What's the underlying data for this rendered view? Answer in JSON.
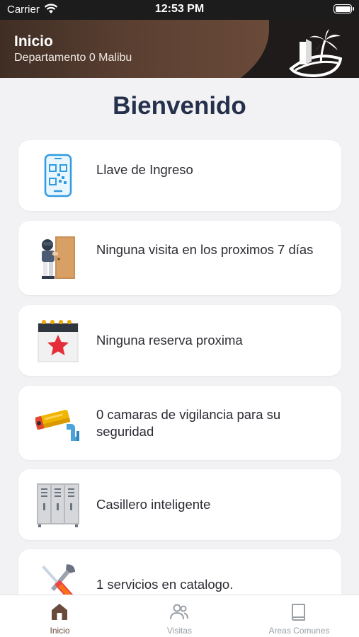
{
  "status_bar": {
    "carrier": "Carrier",
    "time": "12:53 PM"
  },
  "header": {
    "title": "Inicio",
    "subtitle": "Departamento 0 Malibu"
  },
  "welcome": "Bienvenido",
  "cards": [
    {
      "label": "Llave de Ingreso",
      "icon": "qr-phone-icon"
    },
    {
      "label": "Ninguna visita en los proximos 7 días",
      "icon": "visitor-door-icon"
    },
    {
      "label": "Ninguna reserva proxima",
      "icon": "calendar-star-icon"
    },
    {
      "label": "0 camaras de vigilancia para su seguridad",
      "icon": "security-camera-icon"
    },
    {
      "label": "Casillero inteligente",
      "icon": "lockers-icon"
    },
    {
      "label": "1 servicios en catalogo.",
      "icon": "tools-icon"
    }
  ],
  "tabs": [
    {
      "label": "Inicio",
      "icon": "home-icon",
      "active": true
    },
    {
      "label": "Visitas",
      "icon": "people-icon",
      "active": false
    },
    {
      "label": "Areas Comunes",
      "icon": "book-icon",
      "active": false
    }
  ],
  "colors": {
    "header_bg": "#1e1b1a",
    "accent": "#6b4a3e",
    "title": "#25304b"
  }
}
